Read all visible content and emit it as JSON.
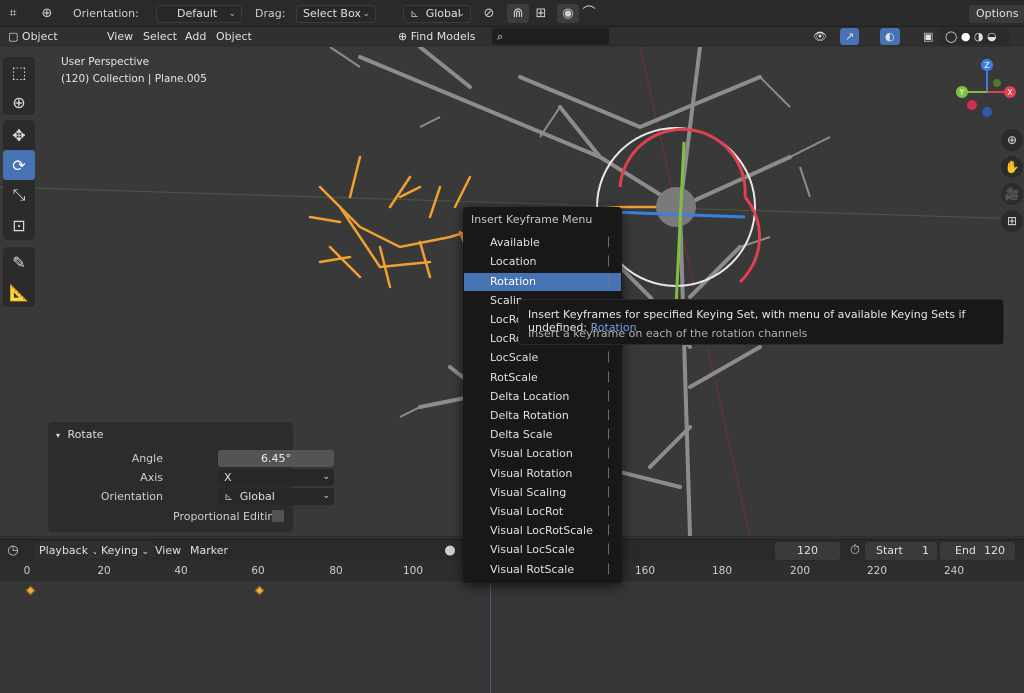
{
  "topbar": {
    "orientation_label": "Orientation:",
    "orientation_value": "Default",
    "drag_label": "Drag:",
    "drag_value": "Select Box",
    "transform_orientation": "Global",
    "options_label": "Options"
  },
  "viewport_header": {
    "mode": "Object Mode",
    "menus": [
      "View",
      "Select",
      "Add",
      "Object"
    ],
    "find_models": "Find Models",
    "search_placeholder": ""
  },
  "viewport": {
    "perspective": "User Perspective",
    "collection_info": "(120) Collection | Plane.005",
    "gizmo_axes": [
      "Z",
      "Y",
      "X"
    ]
  },
  "rotate_panel": {
    "title": "Rotate",
    "angle_label": "Angle",
    "angle_value": "6.45°",
    "axis_label": "Axis",
    "axis_value": "X",
    "orientation_label": "Orientation",
    "orientation_value": "Global",
    "proportional_label": "Proportional Editing"
  },
  "menu": {
    "title": "Insert Keyframe Menu",
    "items": [
      "Available",
      "Location",
      "Rotation",
      "Scaling",
      "LocRot",
      "LocRotScale",
      "LocScale",
      "RotScale",
      "Delta Location",
      "Delta Rotation",
      "Delta Scale",
      "Visual Location",
      "Visual Rotation",
      "Visual Scaling",
      "Visual LocRot",
      "Visual LocRotScale",
      "Visual LocScale",
      "Visual RotScale"
    ],
    "visible_items": [
      "Available",
      "Location",
      "Rotation",
      "Scalin",
      "LocRo",
      "LocRo",
      "LocScale",
      "RotScale",
      "Delta Location",
      "Delta Rotation",
      "Delta Scale",
      "Visual Location",
      "Visual Rotation",
      "Visual Scaling",
      "Visual LocRot",
      "Visual LocRotScale",
      "Visual LocScale",
      "Visual RotScale"
    ],
    "highlighted_index": 2
  },
  "tooltip": {
    "text": "Insert Keyframes for specified Keying Set, with menu of available Keying Sets if undefined:",
    "python_ref": "Rotation",
    "description": "Insert a keyframe on each of the rotation channels"
  },
  "timeline_header": {
    "playback": "Playback",
    "keying": "Keying",
    "view": "View",
    "marker": "Marker",
    "current_frame": "120",
    "start_label": "Start",
    "start_value": "1",
    "end_label": "End",
    "end_value": "120"
  },
  "timeline": {
    "ruler": [
      "0",
      "20",
      "40",
      "60",
      "80",
      "100",
      "160",
      "180",
      "200",
      "220",
      "240"
    ],
    "keyframes": [
      0,
      60
    ]
  },
  "colors": {
    "accent": "#4772b3",
    "selection_orange": "#f0a030",
    "x_axis": "#e04050",
    "y_axis": "#80c040",
    "z_axis": "#3a80e0",
    "keyframe": "#e8b33d"
  }
}
